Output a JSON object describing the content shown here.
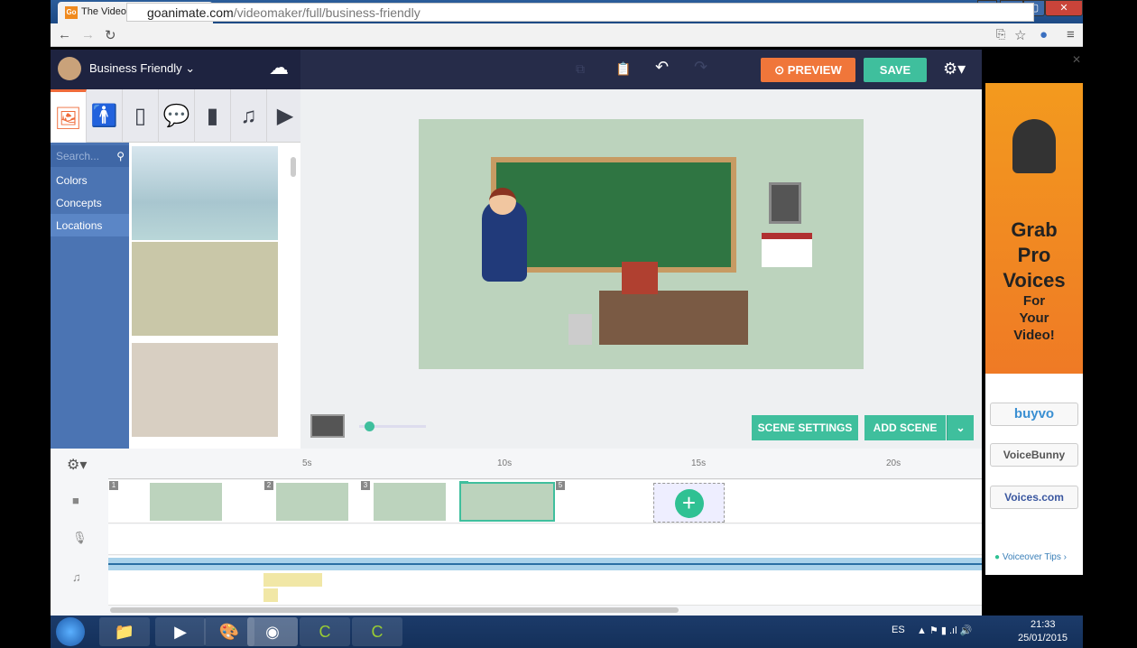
{
  "browser": {
    "tab_title": "The Video Maker from GoAnimate",
    "favicon": "Go",
    "url_domain": "goanimate.com",
    "url_path": "/videomaker/full/business-friendly"
  },
  "header": {
    "theme": "Business Friendly",
    "preview": "PREVIEW",
    "save": "SAVE"
  },
  "categories": [
    "image-icon",
    "character-icon",
    "prop-icon",
    "text-bubble-icon",
    "chart-icon",
    "music-icon",
    "video-icon"
  ],
  "library": {
    "search_placeholder": "Search...",
    "items": [
      "Colors",
      "Concepts",
      "Locations"
    ]
  },
  "stage": {
    "scene_settings": "SCENE SETTINGS",
    "add_scene": "ADD SCENE"
  },
  "timeline": {
    "ticks": [
      "5s",
      "10s",
      "15s",
      "20s"
    ],
    "scenes": [
      "1",
      "2",
      "3",
      "4",
      "5"
    ]
  },
  "ad": {
    "line1": "Grab",
    "line2": "Pro",
    "line3": "Voices",
    "line4": "For",
    "line5": "Your",
    "line6": "Video!",
    "sponsors": [
      "buyvo",
      "VoiceBunny",
      "Voices.com"
    ],
    "tips": "Voiceover Tips ›"
  },
  "taskbar": {
    "lang": "ES",
    "time": "21:33",
    "date": "25/01/2015"
  },
  "colors": {
    "preview": "#f0763a",
    "save": "#3fbf9d",
    "header": "#262c49",
    "sidebar": "#4b74b3"
  }
}
